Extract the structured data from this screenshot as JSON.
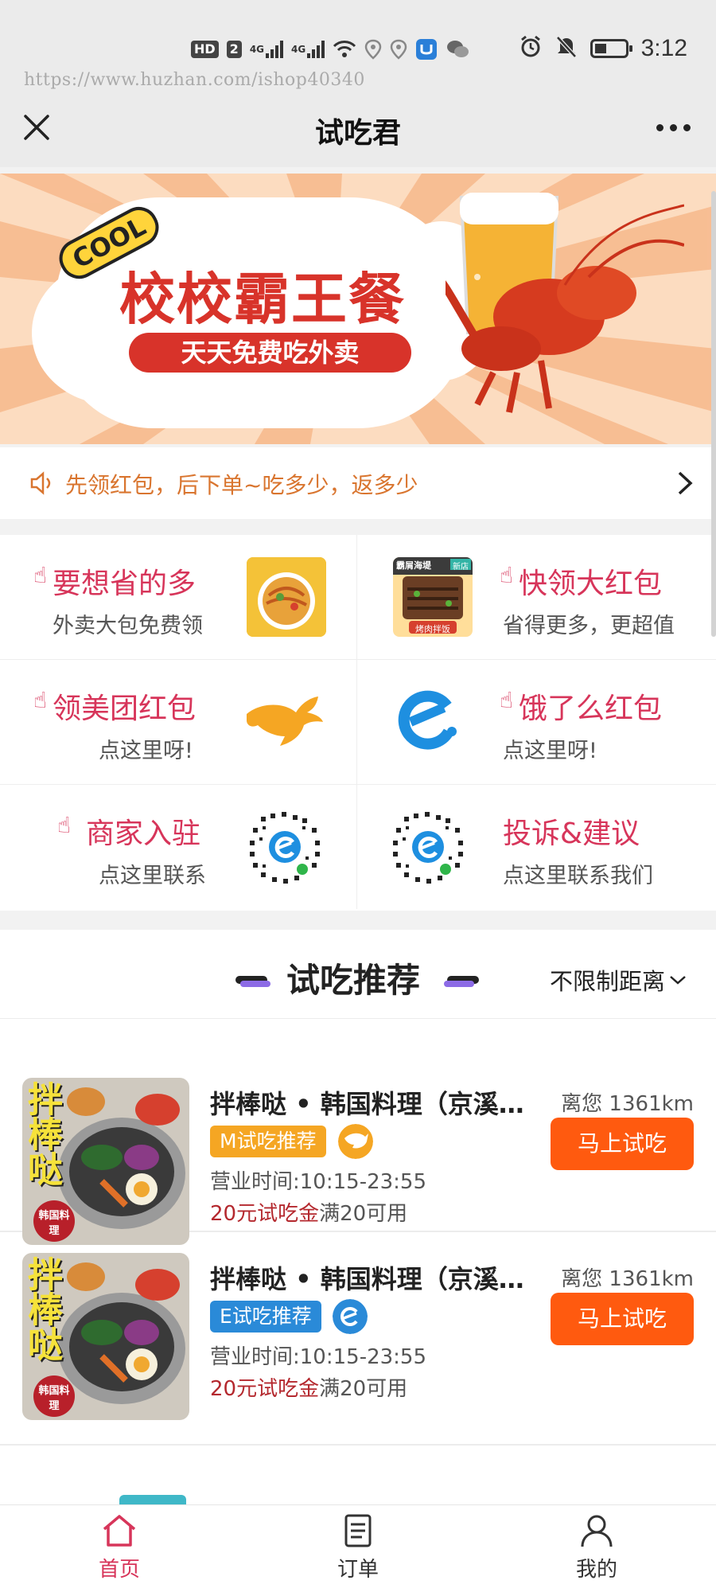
{
  "status_bar": {
    "time": "3:12",
    "network_labels": [
      "HD",
      "2",
      "4G",
      "4G"
    ],
    "watermark": "https://www.huzhan.com/ishop40340"
  },
  "nav": {
    "title": "试吃君",
    "close_icon": "close-icon",
    "more_icon": "more-icon"
  },
  "banner": {
    "badge": "COOL",
    "title": "校校霸王餐",
    "subtitle": "天天免费吃外卖"
  },
  "notice": {
    "text": "先领红包，后下单~吃多少，返多少"
  },
  "grid": {
    "cells": [
      {
        "title": "要想省的多",
        "sub": "外卖大包免费领"
      },
      {
        "title": "快领大红包",
        "sub": "省得更多，更超值",
        "img_caption": "烤肉拌饭",
        "img_label": "霸屑海堤",
        "img_badge": "新店"
      },
      {
        "title": "领美团红包",
        "sub": "点这里呀!"
      },
      {
        "title": "饿了么红包",
        "sub": "点这里呀!"
      },
      {
        "title": "商家入驻",
        "sub": "点这里联系"
      },
      {
        "title": "投诉&建议",
        "sub": "点这里联系我们"
      }
    ]
  },
  "section": {
    "title": "试吃推荐",
    "filter": "不限制距离"
  },
  "items": [
    {
      "name": "拌棒哒 • 韩国料理（京溪…",
      "distance": "离您 1361km",
      "tag": "M试吃推荐",
      "tag_color": "#f5a623",
      "hours": "营业时间:10:15-23:55",
      "gold": "20元试吃金",
      "gold_suffix": "满20可用",
      "button": "马上试吃",
      "img_text": "拌棒哒",
      "img_badge": "韩国料理"
    },
    {
      "name": "拌棒哒 • 韩国料理（京溪…",
      "distance": "离您 1361km",
      "tag": "E试吃推荐",
      "tag_color": "#2a8ad8",
      "hours": "营业时间:10:15-23:55",
      "gold": "20元试吃金",
      "gold_suffix": "满20可用",
      "button": "马上试吃",
      "img_text": "拌棒哒",
      "img_badge": "韩国料理"
    }
  ],
  "tabbar": {
    "tabs": [
      {
        "label": "首页",
        "icon": "home-icon",
        "active": true
      },
      {
        "label": "订单",
        "icon": "order-icon",
        "active": false
      },
      {
        "label": "我的",
        "icon": "profile-icon",
        "active": false
      }
    ],
    "active_color": "#d7355a"
  }
}
